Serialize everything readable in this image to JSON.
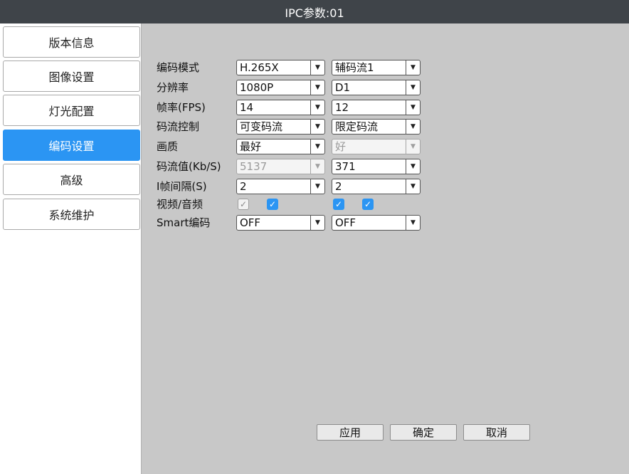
{
  "window": {
    "title": "IPC参数:01"
  },
  "sidebar": {
    "items": [
      {
        "label": "版本信息",
        "active": false
      },
      {
        "label": "图像设置",
        "active": false
      },
      {
        "label": "灯光配置",
        "active": false
      },
      {
        "label": "编码设置",
        "active": true
      },
      {
        "label": "高级",
        "active": false
      },
      {
        "label": "系统维护",
        "active": false
      }
    ]
  },
  "form": {
    "encode_mode": {
      "label": "编码模式",
      "main": "H.265X",
      "sub": "辅码流1"
    },
    "resolution": {
      "label": "分辨率",
      "main": "1080P",
      "sub": "D1"
    },
    "fps": {
      "label": "帧率(FPS)",
      "main": "14",
      "sub": "12"
    },
    "bitrate_control": {
      "label": "码流控制",
      "main": "可变码流",
      "sub": "限定码流"
    },
    "quality": {
      "label": "画质",
      "main": "最好",
      "sub": "好",
      "sub_disabled": true
    },
    "bitrate": {
      "label": "码流值(Kb/S)",
      "main": "5137",
      "main_disabled": true,
      "sub": "371"
    },
    "iframe_interval": {
      "label": "I帧间隔(S)",
      "main": "2",
      "sub": "2"
    },
    "video_audio": {
      "label": "视频/音频",
      "main_video": {
        "checked": true,
        "disabled": true
      },
      "main_audio": {
        "checked": true,
        "disabled": false
      },
      "sub_video": {
        "checked": true,
        "disabled": false
      },
      "sub_audio": {
        "checked": true,
        "disabled": false
      }
    },
    "smart_encode": {
      "label": "Smart编码",
      "main": "OFF",
      "sub": "OFF"
    }
  },
  "buttons": {
    "apply": "应用",
    "ok": "确定",
    "cancel": "取消"
  },
  "icons": {
    "dropdown": "chevron-down-icon",
    "check": "check-icon"
  },
  "colors": {
    "accent": "#2b95f3",
    "titlebar": "#3f4449",
    "panel": "#c8c8c8"
  }
}
